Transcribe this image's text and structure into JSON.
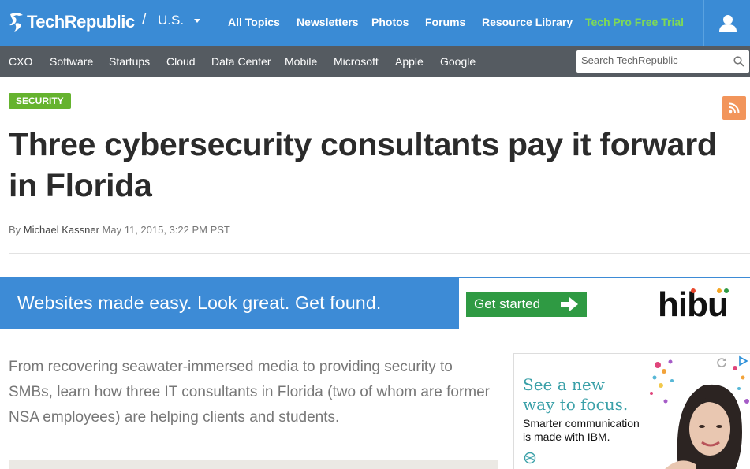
{
  "header": {
    "brand": "TechRepublic",
    "region_separator": "/",
    "region": "U.S.",
    "nav": [
      "All Topics",
      "Newsletters",
      "Photos",
      "Forums",
      "Resource Library",
      "Tech Pro Free Trial"
    ],
    "trial_color": "#7ed957",
    "bar_color": "#3a8bd5"
  },
  "subnav": {
    "items": [
      "CXO",
      "Software",
      "Startups",
      "Cloud",
      "Data Center",
      "Mobile",
      "Microsoft",
      "Apple",
      "Google"
    ],
    "search_placeholder": "Search TechRepublic"
  },
  "article": {
    "category": "SECURITY",
    "title": "Three cybersecurity consultants pay it forward in Florida",
    "by_label": "By",
    "author": "Michael Kassner",
    "date": "May 11, 2015, 3:22 PM PST",
    "deck": "From recovering seawater-immersed media to providing security to SMBs, learn how three IT consultants in Florida (two of whom are former NSA employees) are helping clients and students."
  },
  "banner_ad": {
    "text": "Websites made easy. Look great. Get found.",
    "cta": "Get started",
    "brand": "hibu"
  },
  "side_ad": {
    "headline_line1": "See a new",
    "headline_line2": "way to focus.",
    "sub_line1": "Smarter communication",
    "sub_line2": "is made with IBM."
  }
}
